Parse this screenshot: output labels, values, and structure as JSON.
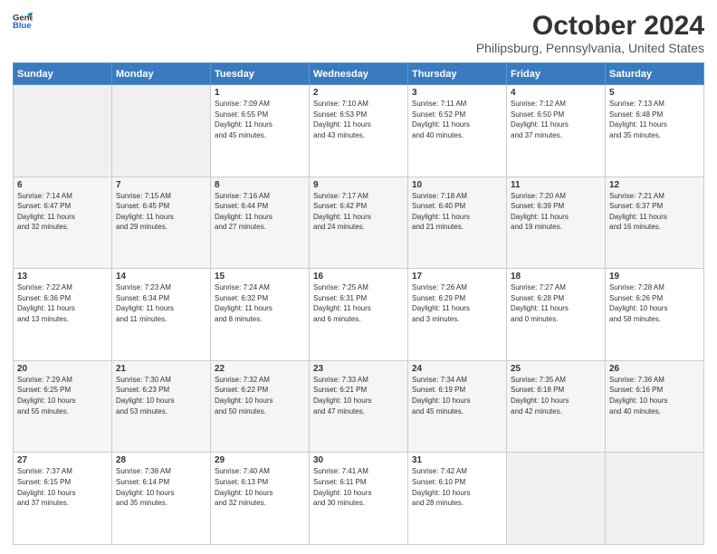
{
  "header": {
    "logo_general": "General",
    "logo_blue": "Blue",
    "title": "October 2024",
    "subtitle": "Philipsburg, Pennsylvania, United States"
  },
  "weekdays": [
    "Sunday",
    "Monday",
    "Tuesday",
    "Wednesday",
    "Thursday",
    "Friday",
    "Saturday"
  ],
  "weeks": [
    [
      {
        "day": "",
        "detail": ""
      },
      {
        "day": "",
        "detail": ""
      },
      {
        "day": "1",
        "detail": "Sunrise: 7:09 AM\nSunset: 6:55 PM\nDaylight: 11 hours\nand 45 minutes."
      },
      {
        "day": "2",
        "detail": "Sunrise: 7:10 AM\nSunset: 6:53 PM\nDaylight: 11 hours\nand 43 minutes."
      },
      {
        "day": "3",
        "detail": "Sunrise: 7:11 AM\nSunset: 6:52 PM\nDaylight: 11 hours\nand 40 minutes."
      },
      {
        "day": "4",
        "detail": "Sunrise: 7:12 AM\nSunset: 6:50 PM\nDaylight: 11 hours\nand 37 minutes."
      },
      {
        "day": "5",
        "detail": "Sunrise: 7:13 AM\nSunset: 6:48 PM\nDaylight: 11 hours\nand 35 minutes."
      }
    ],
    [
      {
        "day": "6",
        "detail": "Sunrise: 7:14 AM\nSunset: 6:47 PM\nDaylight: 11 hours\nand 32 minutes."
      },
      {
        "day": "7",
        "detail": "Sunrise: 7:15 AM\nSunset: 6:45 PM\nDaylight: 11 hours\nand 29 minutes."
      },
      {
        "day": "8",
        "detail": "Sunrise: 7:16 AM\nSunset: 6:44 PM\nDaylight: 11 hours\nand 27 minutes."
      },
      {
        "day": "9",
        "detail": "Sunrise: 7:17 AM\nSunset: 6:42 PM\nDaylight: 11 hours\nand 24 minutes."
      },
      {
        "day": "10",
        "detail": "Sunrise: 7:18 AM\nSunset: 6:40 PM\nDaylight: 11 hours\nand 21 minutes."
      },
      {
        "day": "11",
        "detail": "Sunrise: 7:20 AM\nSunset: 6:39 PM\nDaylight: 11 hours\nand 19 minutes."
      },
      {
        "day": "12",
        "detail": "Sunrise: 7:21 AM\nSunset: 6:37 PM\nDaylight: 11 hours\nand 16 minutes."
      }
    ],
    [
      {
        "day": "13",
        "detail": "Sunrise: 7:22 AM\nSunset: 6:36 PM\nDaylight: 11 hours\nand 13 minutes."
      },
      {
        "day": "14",
        "detail": "Sunrise: 7:23 AM\nSunset: 6:34 PM\nDaylight: 11 hours\nand 11 minutes."
      },
      {
        "day": "15",
        "detail": "Sunrise: 7:24 AM\nSunset: 6:32 PM\nDaylight: 11 hours\nand 8 minutes."
      },
      {
        "day": "16",
        "detail": "Sunrise: 7:25 AM\nSunset: 6:31 PM\nDaylight: 11 hours\nand 6 minutes."
      },
      {
        "day": "17",
        "detail": "Sunrise: 7:26 AM\nSunset: 6:29 PM\nDaylight: 11 hours\nand 3 minutes."
      },
      {
        "day": "18",
        "detail": "Sunrise: 7:27 AM\nSunset: 6:28 PM\nDaylight: 11 hours\nand 0 minutes."
      },
      {
        "day": "19",
        "detail": "Sunrise: 7:28 AM\nSunset: 6:26 PM\nDaylight: 10 hours\nand 58 minutes."
      }
    ],
    [
      {
        "day": "20",
        "detail": "Sunrise: 7:29 AM\nSunset: 6:25 PM\nDaylight: 10 hours\nand 55 minutes."
      },
      {
        "day": "21",
        "detail": "Sunrise: 7:30 AM\nSunset: 6:23 PM\nDaylight: 10 hours\nand 53 minutes."
      },
      {
        "day": "22",
        "detail": "Sunrise: 7:32 AM\nSunset: 6:22 PM\nDaylight: 10 hours\nand 50 minutes."
      },
      {
        "day": "23",
        "detail": "Sunrise: 7:33 AM\nSunset: 6:21 PM\nDaylight: 10 hours\nand 47 minutes."
      },
      {
        "day": "24",
        "detail": "Sunrise: 7:34 AM\nSunset: 6:19 PM\nDaylight: 10 hours\nand 45 minutes."
      },
      {
        "day": "25",
        "detail": "Sunrise: 7:35 AM\nSunset: 6:18 PM\nDaylight: 10 hours\nand 42 minutes."
      },
      {
        "day": "26",
        "detail": "Sunrise: 7:36 AM\nSunset: 6:16 PM\nDaylight: 10 hours\nand 40 minutes."
      }
    ],
    [
      {
        "day": "27",
        "detail": "Sunrise: 7:37 AM\nSunset: 6:15 PM\nDaylight: 10 hours\nand 37 minutes."
      },
      {
        "day": "28",
        "detail": "Sunrise: 7:38 AM\nSunset: 6:14 PM\nDaylight: 10 hours\nand 35 minutes."
      },
      {
        "day": "29",
        "detail": "Sunrise: 7:40 AM\nSunset: 6:13 PM\nDaylight: 10 hours\nand 32 minutes."
      },
      {
        "day": "30",
        "detail": "Sunrise: 7:41 AM\nSunset: 6:11 PM\nDaylight: 10 hours\nand 30 minutes."
      },
      {
        "day": "31",
        "detail": "Sunrise: 7:42 AM\nSunset: 6:10 PM\nDaylight: 10 hours\nand 28 minutes."
      },
      {
        "day": "",
        "detail": ""
      },
      {
        "day": "",
        "detail": ""
      }
    ]
  ]
}
